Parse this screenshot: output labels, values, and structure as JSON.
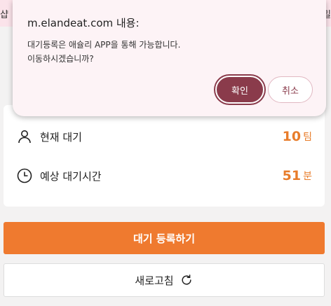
{
  "background_page": {
    "left_edge_text": "샵",
    "right_edge_text": "밀",
    "waiting": {
      "current_label": "현재 대기",
      "current_value": "10",
      "current_unit": "팀",
      "estimated_label": "예상 대기시간",
      "estimated_value": "51",
      "estimated_unit": "분"
    },
    "register_button": "대기 등록하기",
    "refresh_button": "새로고침"
  },
  "dialog": {
    "title": "m.elandeat.com 내용:",
    "message_line1": "대기등록은 애슐리 APP을 통해 가능합니다.",
    "message_line2": "이동하시겠습니까?",
    "ok_label": "확인",
    "cancel_label": "취소"
  },
  "colors": {
    "accent_orange": "#ef7a2f",
    "dialog_primary": "#8a3b4b"
  },
  "icons": {
    "current": "person-icon",
    "estimated": "clock-icon",
    "refresh": "refresh-icon"
  }
}
